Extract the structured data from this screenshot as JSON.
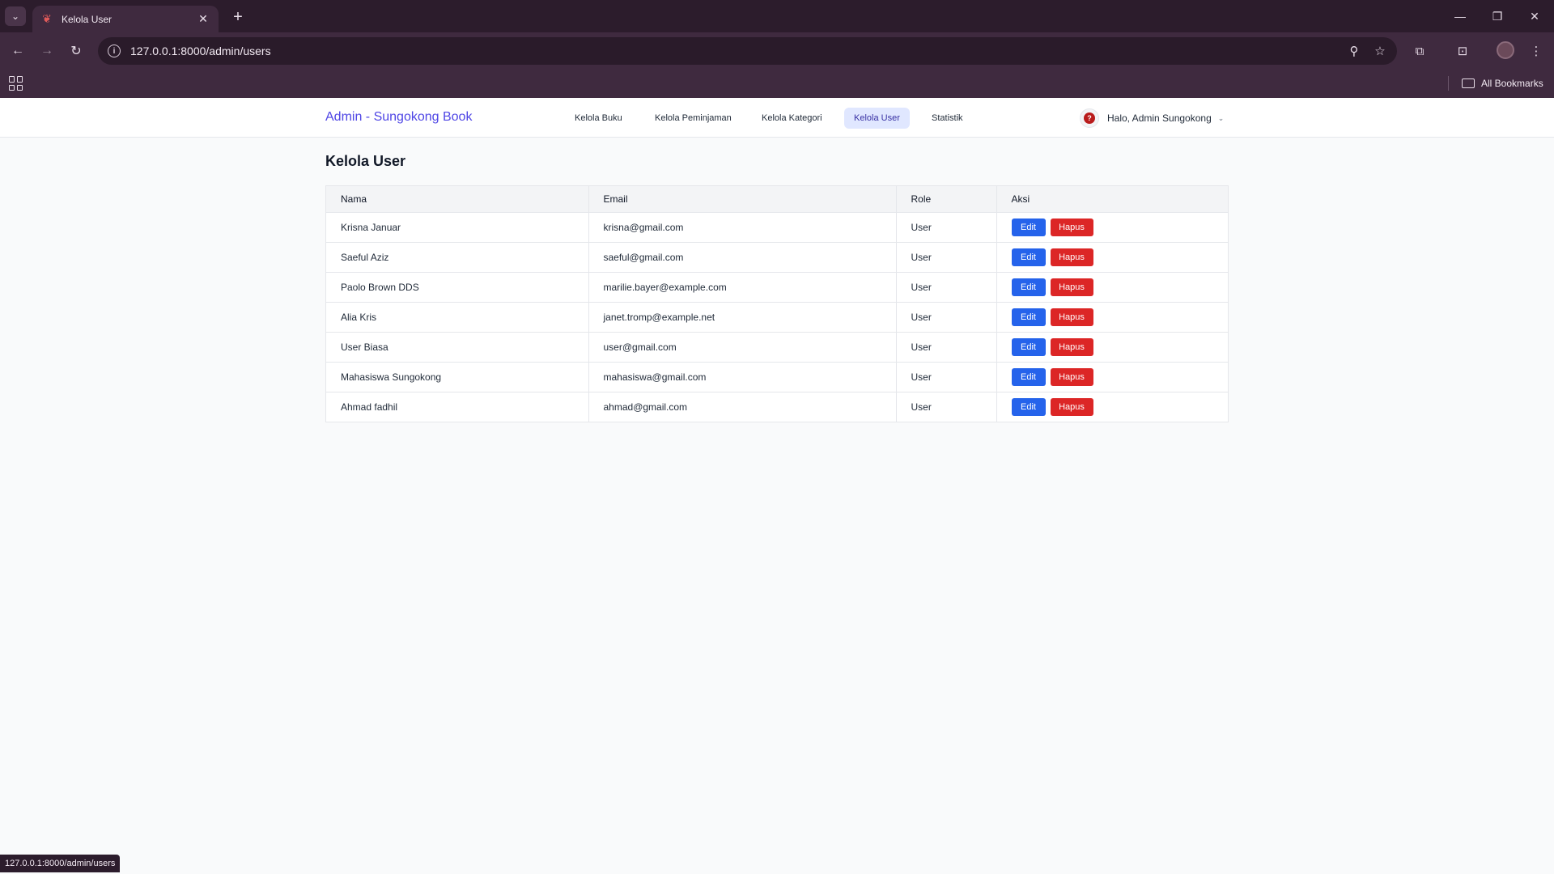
{
  "browser": {
    "tab_title": "Kelola User",
    "url": "127.0.0.1:8000/admin/users",
    "all_bookmarks": "All Bookmarks",
    "status_url": "127.0.0.1:8000/admin/users"
  },
  "navbar": {
    "brand": "Admin - Sungokong Book",
    "items": [
      {
        "label": "Kelola Buku"
      },
      {
        "label": "Kelola Peminjaman"
      },
      {
        "label": "Kelola Kategori"
      },
      {
        "label": "Kelola User",
        "active": true
      },
      {
        "label": "Statistik"
      }
    ],
    "greeting": "Halo, Admin Sungokong"
  },
  "main": {
    "title": "Kelola User",
    "columns": [
      "Nama",
      "Email",
      "Role",
      "Aksi"
    ],
    "edit_label": "Edit",
    "delete_label": "Hapus",
    "rows": [
      {
        "name": "Krisna Januar",
        "email": "krisna@gmail.com",
        "role": "User"
      },
      {
        "name": "Saeful Aziz",
        "email": "saeful@gmail.com",
        "role": "User"
      },
      {
        "name": "Paolo Brown DDS",
        "email": "marilie.bayer@example.com",
        "role": "User"
      },
      {
        "name": "Alia Kris",
        "email": "janet.tromp@example.net",
        "role": "User"
      },
      {
        "name": "User Biasa",
        "email": "user@gmail.com",
        "role": "User"
      },
      {
        "name": "Mahasiswa Sungokong",
        "email": "mahasiswa@gmail.com",
        "role": "User"
      },
      {
        "name": "Ahmad fadhil",
        "email": "ahmad@gmail.com",
        "role": "User"
      }
    ]
  },
  "colors": {
    "brand": "#4f46e5",
    "edit_button": "#2563eb",
    "delete_button": "#dc2626",
    "active_nav_bg": "#e0e7ff"
  }
}
